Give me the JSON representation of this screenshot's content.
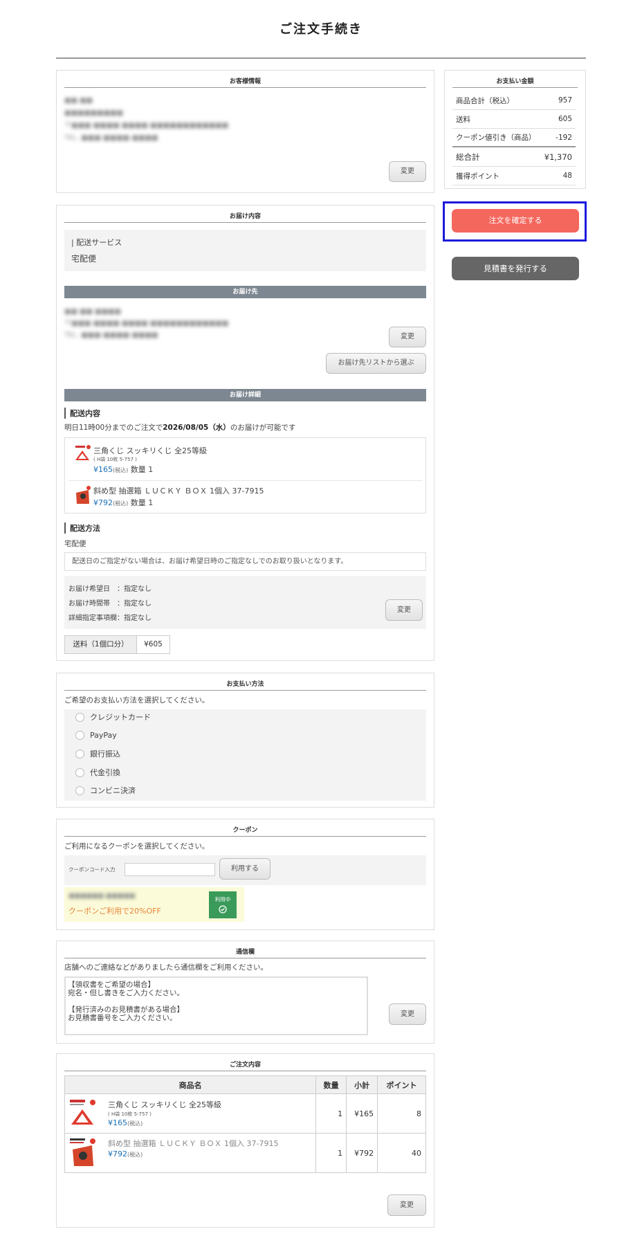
{
  "page_title": "ご注文手続き",
  "customer": {
    "heading": "お客様情報",
    "name": "■■ ■■",
    "company": "■■■■■■■■■",
    "address": "〒■■■-■■■■ ■■■■ ■■■■■■■■■■■■",
    "tel": "TEL. ■■■-■■■■-■■■■",
    "change_label": "変更"
  },
  "delivery": {
    "heading": "お届け内容",
    "service_label": "| 配送サービス",
    "service_value": "宅配便",
    "dest_bar": "お届け先",
    "dest_name": "■■ ■■ ■■■■",
    "dest_address": "〒■■■-■■■■ ■■■■ ■■■■■■■■■■■■",
    "dest_tel": "TEL. ■■■-■■■■-■■■■",
    "dest_change_label": "変更",
    "dest_list_label": "お届け先リストから選ぶ",
    "detail_bar": "お届け詳細",
    "content_title": "配送内容",
    "notice_prefix": "明日11時00分までのご注文で",
    "notice_date": "2026/08/05（水）",
    "notice_suffix": "のお届けが可能です",
    "items": [
      {
        "name": "三角くじ スッキリくじ 全25等級",
        "sub": "( H袋 10枚 5-757 )",
        "price": "¥165",
        "tax": "(税込)",
        "qty": "数量 1"
      },
      {
        "name": "斜め型 抽選箱 ＬＵＣＫＹ ＢＯＸ 1個入 37-7915",
        "sub": "",
        "price": "¥792",
        "tax": "(税込)",
        "qty": "数量 1"
      }
    ],
    "method_title": "配送方法",
    "method_value": "宅配便",
    "method_note": "配送日のご指定がない場合は、お届け希望日時のご指定なしでのお取り扱いとなります。",
    "date_label": "お届け希望日　：指定なし",
    "time_label": "お届け時間帯　：指定なし",
    "detail_label": "詳細指定事項欄：指定なし",
    "method_change_label": "変更",
    "shipping_label": "送料（1個口分）",
    "shipping_value": "¥605"
  },
  "payment": {
    "heading": "お支払い方法",
    "prompt": "ご希望のお支払い方法を選択してください。",
    "options": [
      "クレジットカード",
      "PayPay",
      "銀行振込",
      "代金引換",
      "コンビニ決済"
    ]
  },
  "coupon": {
    "heading": "クーポン",
    "prompt": "ご利用になるクーポンを選択してください。",
    "code_label": "クーポンコード入力",
    "apply_label": "利用する",
    "coupon_name": "■■■■■■ ■■■■■",
    "coupon_desc": "クーポンご利用で20%OFF",
    "in_use_label": "利用中"
  },
  "message": {
    "heading": "通信欄",
    "prompt": "店舗へのご連絡などがありましたら通信欄をご利用ください。",
    "line1": "【領収書をご希望の場合】",
    "line2": "宛名・但し書きをご入力ください。",
    "line3": "【発行済みのお見積書がある場合】",
    "line4": "お見積書番号をご入力ください。",
    "change_label": "変更"
  },
  "order": {
    "heading": "ご注文内容",
    "columns": [
      "商品名",
      "数量",
      "小計",
      "ポイント"
    ],
    "rows": [
      {
        "name": "三角くじ スッキリくじ 全25等級",
        "sub": "( H袋 10枚 5-757 )",
        "price": "¥165",
        "tax": "(税込)",
        "qty": "1",
        "subtotal": "¥165",
        "points": "8"
      },
      {
        "name": "斜め型 抽選箱 ＬＵＣＫＹ ＢＯＸ 1個入 37-7915",
        "sub": "",
        "price": "¥792",
        "tax": "(税込)",
        "qty": "1",
        "subtotal": "¥792",
        "points": "40"
      }
    ],
    "change_label": "変更"
  },
  "summary": {
    "heading": "お支払い金額",
    "rows": [
      {
        "label": "商品合計（税込）",
        "value": "957"
      },
      {
        "label": "送料",
        "value": "605"
      },
      {
        "label": "クーポン値引き（商品）",
        "value": "-192"
      },
      {
        "label": "総合計",
        "value": "¥1,370"
      },
      {
        "label": "獲得ポイント",
        "value": "48"
      }
    ],
    "confirm_label": "注文を確定する",
    "estimate_label": "見積書を発行する"
  },
  "colors": {
    "confirm": "#f4675d",
    "estimate": "#666666",
    "highlight": "#1a1adc",
    "price": "#1a6fb5",
    "coupon_bg": "#fbfbd9",
    "in_use": "#3a9a5a"
  }
}
